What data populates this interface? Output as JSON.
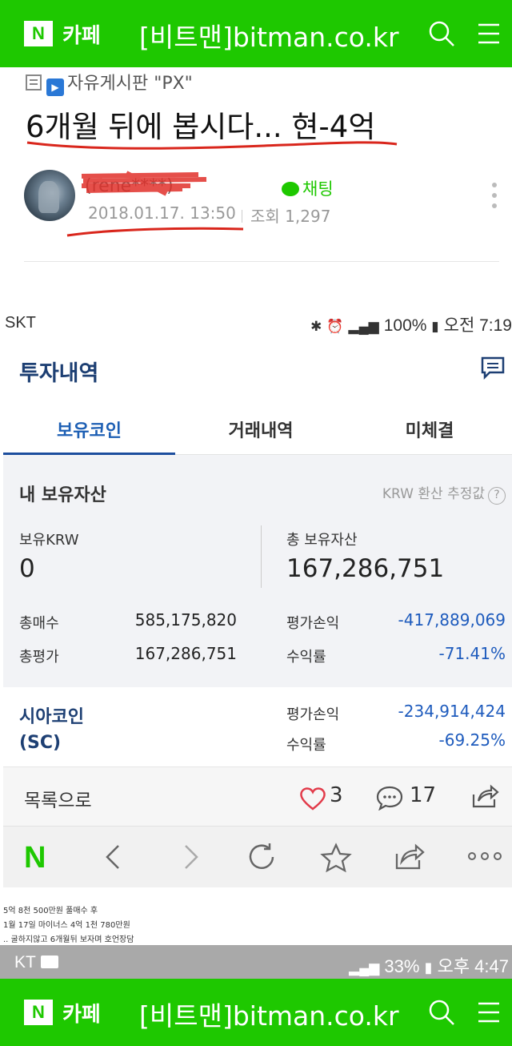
{
  "cafe_header": {
    "logo_letter": "N",
    "cafe_label": "카페",
    "cafe_name": "[비트맨]bitman.co.kr"
  },
  "post": {
    "board": "자유게시판 \"PX\"",
    "title": "6개월 뒤에 봅시다... 현-4억",
    "author_suffix": "rene****)",
    "chat_label": "채팅",
    "date": "2018.01.17. 13:50",
    "views": "조회 1,297"
  },
  "phone_status": {
    "carrier": "SKT",
    "right": "100%",
    "time": "오전 7:19"
  },
  "investment": {
    "title": "투자내역",
    "tabs": [
      "보유코인",
      "거래내역",
      "미체결"
    ],
    "my_assets_heading": "내 보유자산",
    "krw_note": "KRW 환산 추정값",
    "held_krw_label": "보유KRW",
    "held_krw_value": "0",
    "total_assets_label": "총 보유자산",
    "total_assets_value": "167,286,751",
    "total_buy_label": "총매수",
    "total_buy_value": "585,175,820",
    "total_eval_label": "총평가",
    "total_eval_value": "167,286,751",
    "eval_pl_label": "평가손익",
    "eval_pl_value": "-417,889,069",
    "return_label": "수익률",
    "return_value": "-71.41%",
    "coin": {
      "name_line1": "시아코인",
      "name_line2": "(SC)",
      "eval_pl_label": "평가손익",
      "eval_pl_value": "-234,914,424",
      "return_label": "수익률",
      "return_value": "-69.25%"
    }
  },
  "action_bar": {
    "back_label": "목록으로",
    "likes": "3",
    "comments": "17"
  },
  "browser_bar": {
    "logo_letter": "N"
  },
  "caption_lines": [
    "5억 8천 500만원 풀매수 후",
    "1월 17일 마이너스 4억 1천 780만원",
    ".. 굴하지않고 6개월뒤 보자며 호언장담"
  ],
  "bottom_status": {
    "carrier": "KT",
    "battery": "33%",
    "time": "오후 4:47"
  },
  "colors": {
    "naver_green": "#1ec800",
    "navy_title": "#1d3f73",
    "negative_blue": "#1e5bbd",
    "red_mark": "#d9261c"
  }
}
